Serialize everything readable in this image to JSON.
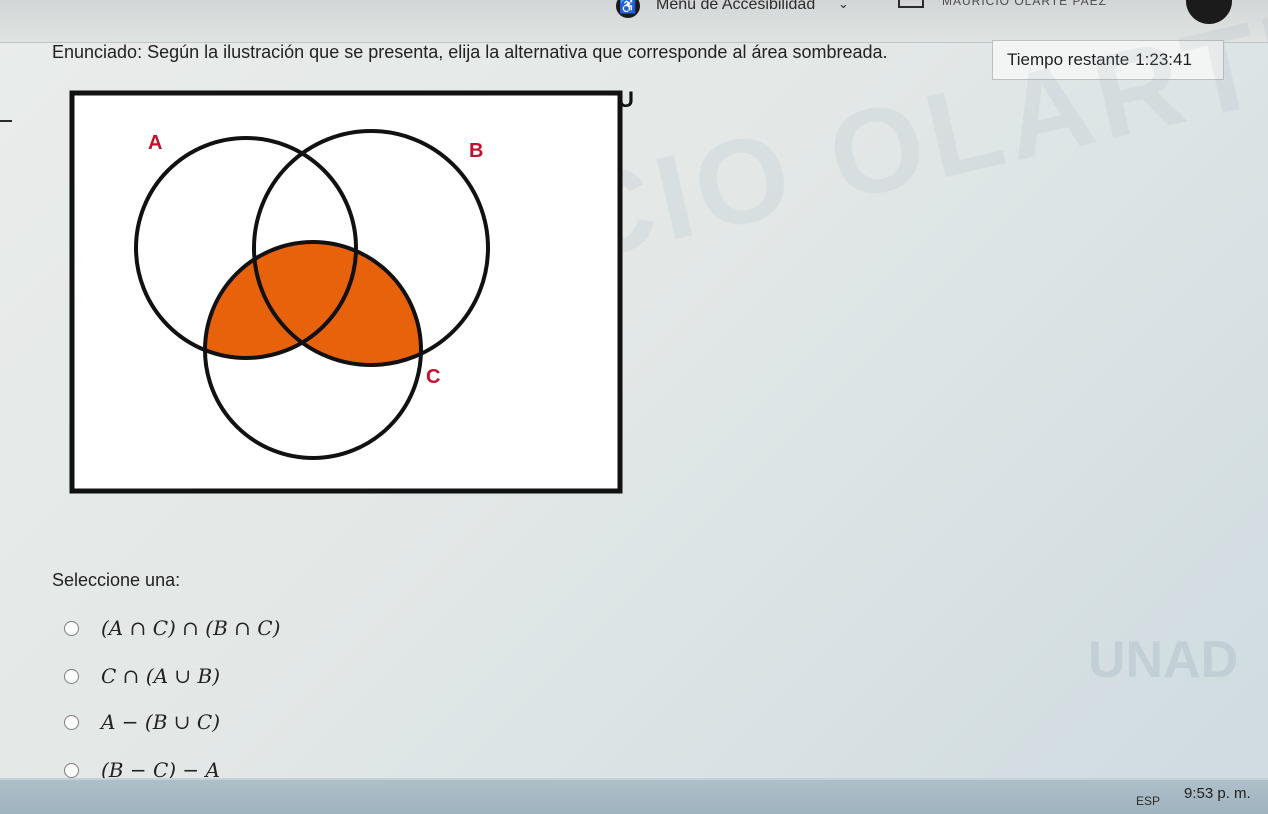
{
  "topbar": {
    "accessibility_menu": "Menú de Accesibilidad",
    "username": "MAURICIO OLARTE PAEZ"
  },
  "question": {
    "statement": "Enunciado: Según la ilustración que se presenta, elija la alternativa que corresponde al área sombreada."
  },
  "timer": {
    "label": "Tiempo restante",
    "value": "1:23:41"
  },
  "diagram": {
    "universe_label": "U",
    "set_a_label": "A",
    "set_b_label": "B",
    "set_c_label": "C",
    "shade_color": "#e8620c",
    "frame_color": "#111111",
    "label_color": "#c0122e"
  },
  "watermark": {
    "text": "MAURICIO OLARTE PAEZ",
    "logo": "UNAD"
  },
  "answers": {
    "prompt": "Seleccione una:",
    "options": [
      {
        "label": "(A ∩ C) ∩ (B ∩ C)"
      },
      {
        "label": "C ∩ (A ∪ B)"
      },
      {
        "label": "A − (B ∪ C)"
      },
      {
        "label": "(B − C) − A"
      }
    ]
  },
  "taskbar": {
    "language": "ESP",
    "time": "9:53 p. m."
  }
}
